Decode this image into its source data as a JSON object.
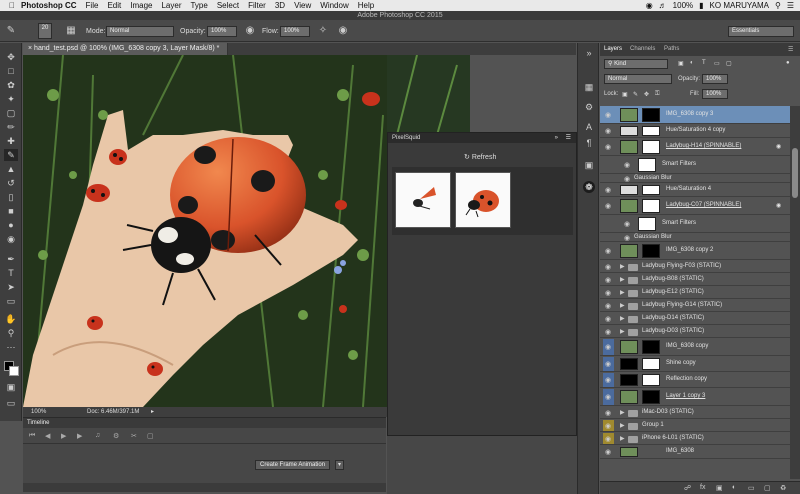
{
  "menubar": {
    "app": "Photoshop CC",
    "items": [
      "File",
      "Edit",
      "Image",
      "Layer",
      "Type",
      "Select",
      "Filter",
      "3D",
      "View",
      "Window",
      "Help"
    ],
    "battery": "100%",
    "user": "KO MARUYAMA"
  },
  "window_title": "Adobe Photoshop CC 2015",
  "options": {
    "brush_size": "20",
    "mode_label": "Mode:",
    "mode_value": "Normal",
    "opacity_label": "Opacity:",
    "opacity_value": "100%",
    "flow_label": "Flow:",
    "flow_value": "100%",
    "workspace": "Essentials"
  },
  "document": {
    "tab_title": "hand_test.psd @ 100% (IMG_6308 copy 3, Layer Mask/8) *",
    "zoom": "100%",
    "doc_info": "Doc: 6.46M/397.1M"
  },
  "pixelsquid": {
    "title": "PixelSquid",
    "refresh_label": "Refresh"
  },
  "timeline": {
    "title": "Timeline",
    "create_button": "Create Frame Animation"
  },
  "layers_panel": {
    "tabs": [
      "Layers",
      "Channels",
      "Paths"
    ],
    "filter_kind": "Kind",
    "blend_mode": "Normal",
    "opacity_label": "Opacity:",
    "opacity_value": "100%",
    "lock_label": "Lock:",
    "fill_label": "Fill:",
    "fill_value": "100%",
    "layers": [
      {
        "name": "IMG_6308 copy 3",
        "kind": "image-mask",
        "selected": true
      },
      {
        "name": "Hue/Saturation 4 copy",
        "kind": "adjust"
      },
      {
        "name": "Ladybug-H14 (SPINNABLE)",
        "kind": "smart"
      },
      {
        "name": "Smart Filters",
        "kind": "filter-mask"
      },
      {
        "name": "Gaussian Blur",
        "kind": "filter-item"
      },
      {
        "name": "Hue/Saturation 4",
        "kind": "adjust"
      },
      {
        "name": "Ladybug-C07 (SPINNABLE)",
        "kind": "smart"
      },
      {
        "name": "Smart Filters",
        "kind": "filter-mask"
      },
      {
        "name": "Gaussian Blur",
        "kind": "filter-item"
      },
      {
        "name": "IMG_6308 copy 2",
        "kind": "image-mask"
      },
      {
        "name": "Ladybug Flying-F03 (STATIC)",
        "kind": "folder"
      },
      {
        "name": "Ladybug-B08 (STATIC)",
        "kind": "folder"
      },
      {
        "name": "Ladybug-E12 (STATIC)",
        "kind": "folder"
      },
      {
        "name": "Ladybug Flying-G14 (STATIC)",
        "kind": "folder"
      },
      {
        "name": "Ladybug-D14 (STATIC)",
        "kind": "folder"
      },
      {
        "name": "Ladybug-D03 (STATIC)",
        "kind": "folder"
      },
      {
        "name": "IMG_6308 copy",
        "kind": "image-mask",
        "tag": "blue"
      },
      {
        "name": "Shine copy",
        "kind": "mask-only",
        "tag": "blue"
      },
      {
        "name": "Reflection copy",
        "kind": "mask-only",
        "tag": "blue"
      },
      {
        "name": "Layer 1 copy 3",
        "kind": "image-mask",
        "tag": "blue"
      },
      {
        "name": "iMac-D03 (STATIC)",
        "kind": "folder"
      },
      {
        "name": "Group 1",
        "kind": "folder",
        "tag": "yellow"
      },
      {
        "name": "iPhone 6-L01 (STATIC)",
        "kind": "folder",
        "tag": "yellow"
      },
      {
        "name": "IMG_6308",
        "kind": "image"
      }
    ]
  },
  "colors": {
    "selection": "#6c8fb8",
    "label_blue": "#4b6b9e",
    "label_yellow": "#a08a2f",
    "ladybug_red": "#d9532b"
  }
}
